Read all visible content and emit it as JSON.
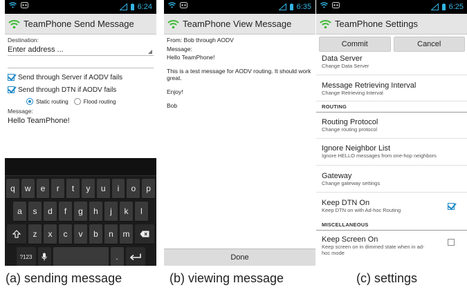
{
  "captions": {
    "a": "(a) sending message",
    "b": "(b) viewing message",
    "c": "(c) settings"
  },
  "colors": {
    "accent": "#33b5e5",
    "wifi_icon": "#3dbb33",
    "checkbox": "#1e88c8"
  },
  "send": {
    "status_time": "6:24",
    "title": "TeamPhone Send Message",
    "destination_label": "Destination:",
    "address_placeholder": "Enter address ...",
    "chk_server": "Send through Server if AODV fails",
    "chk_dtn": "Send through DTN if AODV fails",
    "radio_static": "Static routing",
    "radio_flood": "Flood routing",
    "message_label": "Message:",
    "message_value": "Hello TeamPhone!",
    "keyboard": {
      "row1": [
        "q",
        "w",
        "e",
        "r",
        "t",
        "y",
        "u",
        "i",
        "o",
        "p"
      ],
      "row2": [
        "a",
        "s",
        "d",
        "f",
        "g",
        "h",
        "j",
        "k",
        "l"
      ],
      "row3": [
        "z",
        "x",
        "c",
        "v",
        "b",
        "n",
        "m"
      ],
      "key_symbols": "?123",
      "key_period": "."
    }
  },
  "view": {
    "status_time": "6:35",
    "title": "TeamPhone View Message",
    "from": "From: Bob through AODV",
    "message_label": "Message:",
    "line1": "Hello TeamPhone!",
    "line2": "This is a test message for AODV routing. It should work great.",
    "line3": "Enjoy!",
    "line4": "Bob",
    "done": "Done"
  },
  "settings": {
    "status_time": "6:25",
    "title": "TeamPhone Settings",
    "commit": "Commit",
    "cancel": "Cancel",
    "data_server_title": "Data Server",
    "data_server_sum": "Change Data Server",
    "retr_title": "Message Retrieving Interval",
    "retr_sum": "Change Retrieving Interval",
    "cat_routing": "ROUTING",
    "rp_title": "Routing Protocol",
    "rp_sum": "Change routing protocol",
    "inl_title": "Ignore Neighbor List",
    "inl_sum": "Ignore HELLO messages from one-hop neighbors",
    "gw_title": "Gateway",
    "gw_sum": "Change gateway settings",
    "dtn_title": "Keep DTN On",
    "dtn_sum": "Keep DTN on with Ad-hoc Routing",
    "cat_misc": "MISCELLANEOUS",
    "ks_title": "Keep Screen On",
    "ks_sum": "Keep screen on in dimmed state when in ad-hoc mode"
  }
}
